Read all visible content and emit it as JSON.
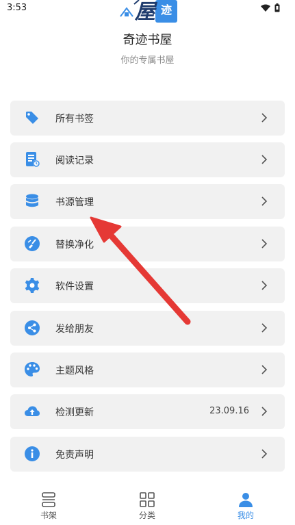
{
  "status_bar": {
    "time": "3:53"
  },
  "header": {
    "app_name": "奇迹书屋",
    "subtitle": "你的专属书屋"
  },
  "menu": [
    {
      "label": "所有书签",
      "icon": "bookmark-tag-icon",
      "value": ""
    },
    {
      "label": "阅读记录",
      "icon": "reading-history-icon",
      "value": ""
    },
    {
      "label": "书源管理",
      "icon": "database-icon",
      "value": ""
    },
    {
      "label": "替换净化",
      "icon": "clean-brush-icon",
      "value": ""
    },
    {
      "label": "软件设置",
      "icon": "gear-icon",
      "value": ""
    },
    {
      "label": "发给朋友",
      "icon": "share-icon",
      "value": ""
    },
    {
      "label": "主题风格",
      "icon": "palette-icon",
      "value": ""
    },
    {
      "label": "检测更新",
      "icon": "cloud-upload-icon",
      "value": "23.09.16"
    },
    {
      "label": "免责声明",
      "icon": "info-icon",
      "value": ""
    }
  ],
  "bottom_nav": [
    {
      "label": "书架",
      "icon": "bookshelf-icon",
      "active": false
    },
    {
      "label": "分类",
      "icon": "category-grid-icon",
      "active": false
    },
    {
      "label": "我的",
      "icon": "profile-icon",
      "active": true
    }
  ],
  "colors": {
    "accent": "#3a8ee6",
    "menu_bg": "#f1f1f1",
    "annotation": "#e53935"
  }
}
